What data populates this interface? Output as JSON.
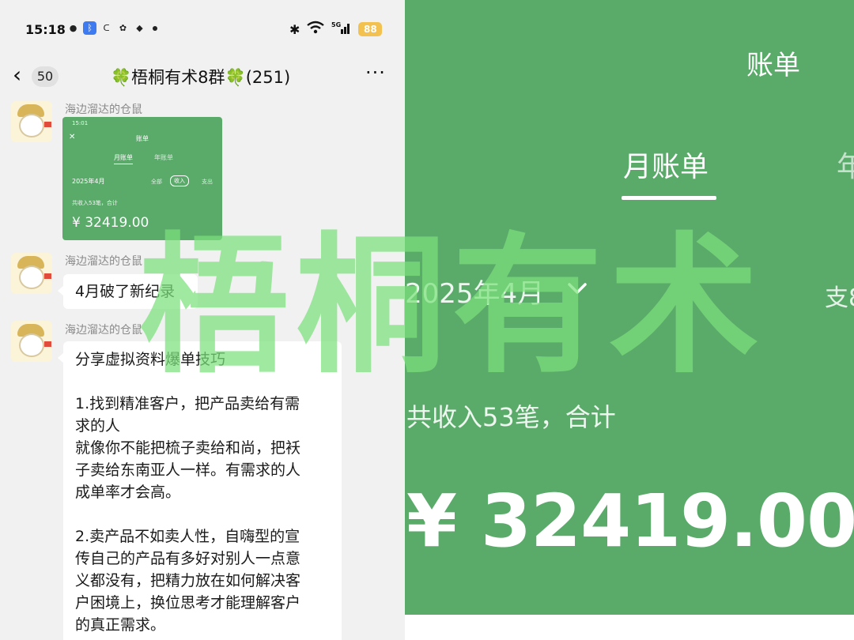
{
  "chat": {
    "status": {
      "time": "15:18",
      "battery": "88",
      "signal_label": "5G"
    },
    "nav": {
      "back_count": "50",
      "group_title": "梧桐有术8群",
      "member_count": "(251)",
      "clover": "🍀"
    },
    "sender": "海边溜达的仓鼠",
    "image_message": {
      "time": "15:01",
      "title": "账单",
      "tab_month": "月账单",
      "tab_year": "年账单",
      "month": "2025年4月",
      "filter_all": "全部",
      "filter_income": "收入",
      "filter_expense": "支出",
      "summary": "共收入53笔，合计",
      "amount": "¥ 32419.00"
    },
    "message_1": "4月破了新纪录",
    "message_2_lines": [
      "分享虚拟资料爆单技巧",
      "",
      "1.找到精准客户，把产品卖给有需",
      "求的人",
      "就像你不能把梳子卖给和尚，把袄",
      "子卖给东南亚人一样。有需求的人",
      "成单率才会高。",
      "",
      "2.卖产品不如卖人性，自嗨型的宣",
      "传自己的产品有多好对别人一点意",
      "义都没有，把精力放在如何解决客",
      "户困境上，换位思考才能理解客户",
      "的真正需求。"
    ]
  },
  "bill": {
    "title": "账单",
    "tab_month": "月账单",
    "tab_year_partial": "年",
    "month": "2025年4月",
    "filter_partial": "支8",
    "summary": "共收入53笔，合计",
    "amount": "¥ 32419.00"
  },
  "watermark": "梧桐有术",
  "colors": {
    "bill_green": "#5aaa6a",
    "watermark_green": "#7ce07c",
    "chat_bg": "#f1f1f1",
    "battery": "#f3c14f"
  }
}
